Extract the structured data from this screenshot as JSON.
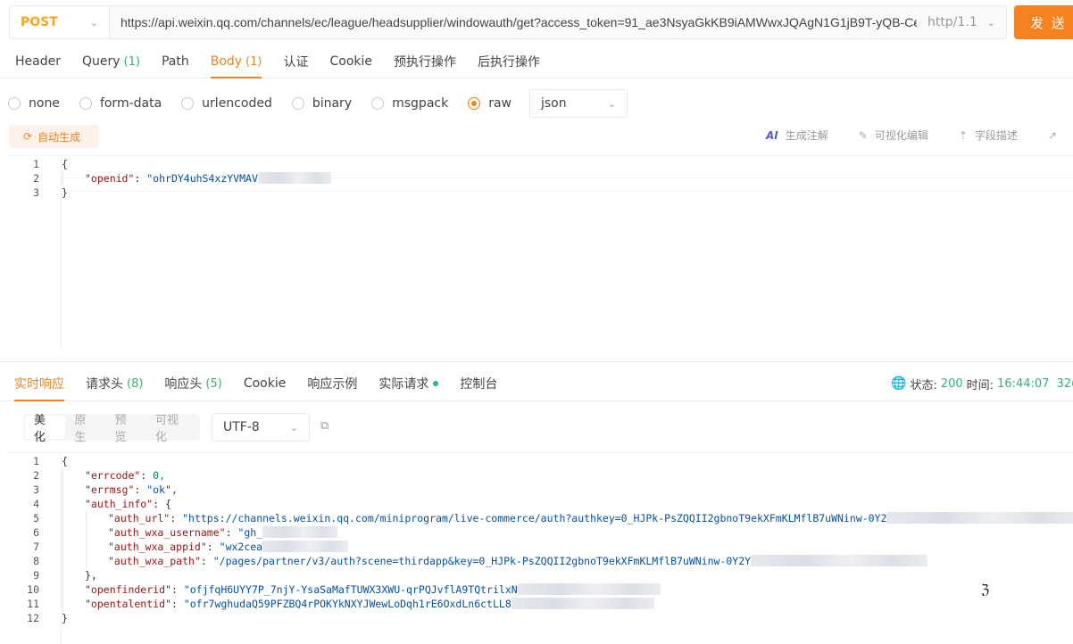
{
  "request": {
    "method": "POST",
    "url": "https://api.weixin.qq.com/channels/ec/league/headsupplier/windowauth/get?access_token=91_ae3NsyaGkKB9iAMWwxJQAgN1G1jB9T-yQB-Ce",
    "protocol": "http/1.1",
    "send_label": "发 送"
  },
  "request_tabs": [
    {
      "label": "Header",
      "count": ""
    },
    {
      "label": "Query",
      "count": "(1)"
    },
    {
      "label": "Path",
      "count": ""
    },
    {
      "label": "Body",
      "count": "(1)"
    },
    {
      "label": "认证",
      "count": ""
    },
    {
      "label": "Cookie",
      "count": ""
    },
    {
      "label": "预执行操作",
      "count": ""
    },
    {
      "label": "后执行操作",
      "count": ""
    }
  ],
  "body_types": [
    "none",
    "form-data",
    "urlencoded",
    "binary",
    "msgpack",
    "raw"
  ],
  "body_type_selected": "raw",
  "raw_format": "json",
  "toolbar": {
    "autogen": "自动生成",
    "ai_comment": "生成注解",
    "visual_edit": "可视化编辑",
    "field_desc": "字段描述"
  },
  "request_body": {
    "line_numbers": [
      "1",
      "2",
      "3"
    ],
    "open": "{",
    "key": "\"openid\"",
    "colon": ": ",
    "value": "\"ohrDY4uhS4xzYVMAV",
    "close": "}"
  },
  "response_tabs": [
    {
      "label": "实时响应",
      "count": ""
    },
    {
      "label": "请求头",
      "count": "(8)"
    },
    {
      "label": "响应头",
      "count": "(5)"
    },
    {
      "label": "Cookie",
      "count": ""
    },
    {
      "label": "响应示例",
      "count": ""
    },
    {
      "label": "实际请求",
      "count": ""
    },
    {
      "label": "控制台",
      "count": ""
    }
  ],
  "status": {
    "status_label": "状态:",
    "status_code": "200",
    "time_label": "时间:",
    "time_value": "16:44:07",
    "extra": "32("
  },
  "view_modes": [
    "美化",
    "原生",
    "预览",
    "可视化"
  ],
  "encoding": "UTF-8",
  "response_body": {
    "line_numbers": [
      "1",
      "2",
      "3",
      "4",
      "5",
      "6",
      "7",
      "8",
      "9",
      "10",
      "11",
      "12"
    ],
    "l1": "{",
    "errcode_key": "\"errcode\"",
    "errcode_val": "0,",
    "errmsg_key": "\"errmsg\"",
    "errmsg_val": "\"ok\",",
    "auth_info_key": "\"auth_info\"",
    "auth_info_open": "{",
    "auth_url_key": "\"auth_url\"",
    "auth_url_val": "\"https://channels.weixin.qq.com/miniprogram/live-commerce/auth?authkey=0_HJPk-PsZQQII2gbnoT9ekXFmKLMflB7uWNinw-0Y2",
    "auth_wxa_username_key": "\"auth_wxa_username\"",
    "auth_wxa_username_val": "\"gh_",
    "auth_wxa_appid_key": "\"auth_wxa_appid\"",
    "auth_wxa_appid_val": "\"wx2cea",
    "auth_wxa_path_key": "\"auth_wxa_path\"",
    "auth_wxa_path_val": "\"/pages/partner/v3/auth?scene=thirdapp&key=0_HJPk-PsZQQII2gbnoT9ekXFmKLMflB7uWNinw-0Y2Y",
    "auth_info_close": "},",
    "openfinderid_key": "\"openfinderid\"",
    "openfinderid_val": "\"ofjfqH6UYY7P_7njY-YsaSaMafTUWX3XWU-qrPQJvflA9TQtrilxN",
    "opentalentid_key": "\"opentalentid\"",
    "opentalentid_val": "\"ofr7wghudaQ59PFZBQ4rPOKYkNXYJWewLoDqh1rE6OxdLn6ctLL8",
    "l12": "}"
  },
  "colors": {
    "accent": "#f5811f",
    "method": "#f5a623",
    "success": "#2eb67d",
    "json_key": "#a31515",
    "json_string": "#0451a5"
  },
  "icons": [
    "chevron-down-icon",
    "refresh-icon",
    "ai-icon",
    "edit-icon",
    "upload-icon",
    "pin-icon",
    "globe-icon",
    "copy-icon",
    "text-cursor-icon"
  ]
}
